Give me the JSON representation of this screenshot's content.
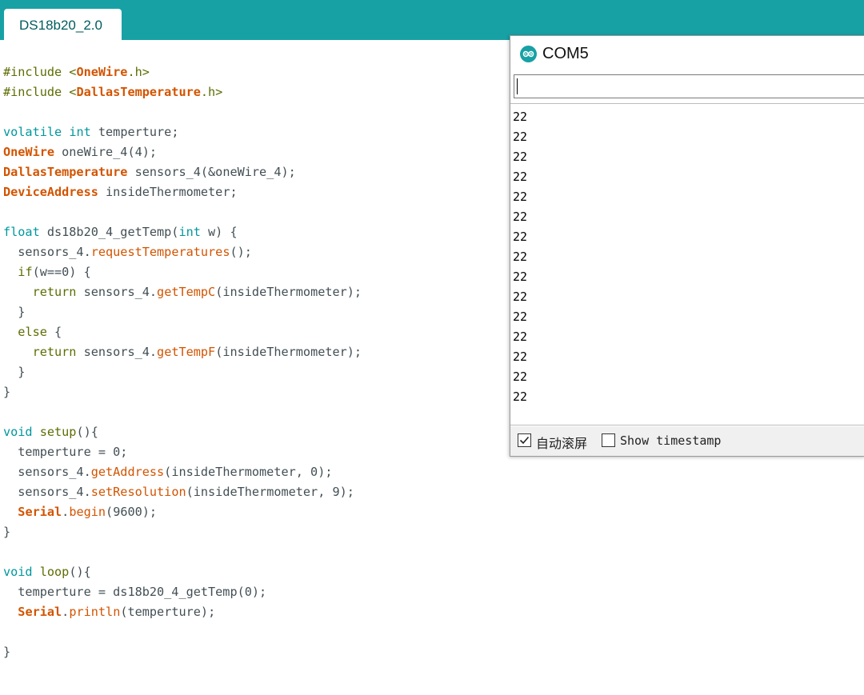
{
  "tab": {
    "label": "DS18b20_2.0"
  },
  "editor": {
    "lines": [
      [
        {
          "t": "#include <",
          "c": "pp"
        },
        {
          "t": "OneWire",
          "c": "ty"
        },
        {
          "t": ".h>",
          "c": "pp"
        }
      ],
      [
        {
          "t": "#include <",
          "c": "pp"
        },
        {
          "t": "DallasTemperature",
          "c": "ty"
        },
        {
          "t": ".h>",
          "c": "pp"
        }
      ],
      [],
      [
        {
          "t": "volatile",
          "c": "kw"
        },
        {
          "t": " ",
          "c": "tx"
        },
        {
          "t": "int",
          "c": "kw"
        },
        {
          "t": " temperture;",
          "c": "tx"
        }
      ],
      [
        {
          "t": "OneWire",
          "c": "ty"
        },
        {
          "t": " oneWire_4(4);",
          "c": "tx"
        }
      ],
      [
        {
          "t": "DallasTemperature",
          "c": "ty"
        },
        {
          "t": " sensors_4(&oneWire_4);",
          "c": "tx"
        }
      ],
      [
        {
          "t": "DeviceAddress",
          "c": "ty"
        },
        {
          "t": " insideThermometer;",
          "c": "tx"
        }
      ],
      [],
      [
        {
          "t": "float",
          "c": "kw"
        },
        {
          "t": " ds18b20_4_getTemp(",
          "c": "tx"
        },
        {
          "t": "int",
          "c": "kw"
        },
        {
          "t": " w) {",
          "c": "tx"
        }
      ],
      [
        {
          "t": "  sensors_4.",
          "c": "tx"
        },
        {
          "t": "requestTemperatures",
          "c": "fn"
        },
        {
          "t": "();",
          "c": "tx"
        }
      ],
      [
        {
          "t": "  ",
          "c": "tx"
        },
        {
          "t": "if",
          "c": "pp"
        },
        {
          "t": "(w==0) {",
          "c": "tx"
        }
      ],
      [
        {
          "t": "    ",
          "c": "tx"
        },
        {
          "t": "return",
          "c": "pp"
        },
        {
          "t": " sensors_4.",
          "c": "tx"
        },
        {
          "t": "getTempC",
          "c": "fn"
        },
        {
          "t": "(insideThermometer);",
          "c": "tx"
        }
      ],
      [
        {
          "t": "  }",
          "c": "tx"
        }
      ],
      [
        {
          "t": "  ",
          "c": "tx"
        },
        {
          "t": "else",
          "c": "pp"
        },
        {
          "t": " {",
          "c": "tx"
        }
      ],
      [
        {
          "t": "    ",
          "c": "tx"
        },
        {
          "t": "return",
          "c": "pp"
        },
        {
          "t": " sensors_4.",
          "c": "tx"
        },
        {
          "t": "getTempF",
          "c": "fn"
        },
        {
          "t": "(insideThermometer);",
          "c": "tx"
        }
      ],
      [
        {
          "t": "  }",
          "c": "tx"
        }
      ],
      [
        {
          "t": "}",
          "c": "tx"
        }
      ],
      [],
      [
        {
          "t": "void",
          "c": "kw"
        },
        {
          "t": " ",
          "c": "tx"
        },
        {
          "t": "setup",
          "c": "pp"
        },
        {
          "t": "(){",
          "c": "tx"
        }
      ],
      [
        {
          "t": "  temperture = 0;",
          "c": "tx"
        }
      ],
      [
        {
          "t": "  sensors_4.",
          "c": "tx"
        },
        {
          "t": "getAddress",
          "c": "fn"
        },
        {
          "t": "(insideThermometer, 0);",
          "c": "tx"
        }
      ],
      [
        {
          "t": "  sensors_4.",
          "c": "tx"
        },
        {
          "t": "setResolution",
          "c": "fn"
        },
        {
          "t": "(insideThermometer, 9);",
          "c": "tx"
        }
      ],
      [
        {
          "t": "  ",
          "c": "tx"
        },
        {
          "t": "Serial",
          "c": "ty"
        },
        {
          "t": ".",
          "c": "tx"
        },
        {
          "t": "begin",
          "c": "fn"
        },
        {
          "t": "(9600);",
          "c": "tx"
        }
      ],
      [
        {
          "t": "}",
          "c": "tx"
        }
      ],
      [],
      [
        {
          "t": "void",
          "c": "kw"
        },
        {
          "t": " ",
          "c": "tx"
        },
        {
          "t": "loop",
          "c": "pp"
        },
        {
          "t": "(){",
          "c": "tx"
        }
      ],
      [
        {
          "t": "  temperture = ds18b20_4_getTemp(0);",
          "c": "tx"
        }
      ],
      [
        {
          "t": "  ",
          "c": "tx"
        },
        {
          "t": "Serial",
          "c": "ty"
        },
        {
          "t": ".",
          "c": "tx"
        },
        {
          "t": "println",
          "c": "fn"
        },
        {
          "t": "(temperture);",
          "c": "tx"
        }
      ],
      [],
      [
        {
          "t": "}",
          "c": "tx"
        }
      ]
    ]
  },
  "serial_monitor": {
    "title": "COM5",
    "input_value": "",
    "output": [
      "22",
      "22",
      "22",
      "22",
      "22",
      "22",
      "22",
      "22",
      "22",
      "22",
      "22",
      "22",
      "22",
      "22",
      "22"
    ],
    "autoscroll": {
      "label": "自动滚屏",
      "checked": true
    },
    "timestamp": {
      "label": "Show timestamp",
      "checked": false
    }
  },
  "colors": {
    "tab_bar": "#17a1a5",
    "keyword": "#00979c",
    "type": "#d35400",
    "preprocessor": "#5e6d03",
    "text": "#434f54"
  }
}
